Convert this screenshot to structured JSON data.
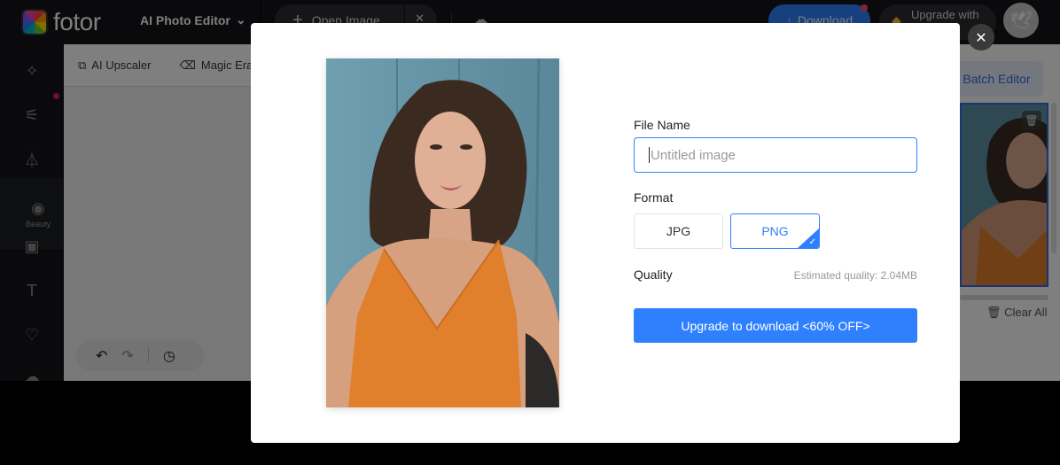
{
  "topbar": {
    "logo_text": "fotor",
    "editor_menu_label": "AI Photo Editor",
    "open_image_label": "Open Image",
    "download_label": "Download",
    "upgrade_label": "Upgrade with"
  },
  "sidebar": {
    "items": [
      {
        "icon": "ai-tools-icon",
        "glyph": "✧",
        "label": ""
      },
      {
        "icon": "adjust-icon",
        "glyph": "⚟",
        "label": ""
      },
      {
        "icon": "effects-icon",
        "glyph": "⏃",
        "label": ""
      },
      {
        "icon": "beauty-eye-icon",
        "glyph": "◉",
        "label": "Beauty"
      },
      {
        "icon": "frame-icon",
        "glyph": "▣",
        "label": ""
      },
      {
        "icon": "text-icon",
        "glyph": "T",
        "label": ""
      },
      {
        "icon": "elements-icon",
        "glyph": "♡",
        "label": ""
      },
      {
        "icon": "upload-icon",
        "glyph": "☁",
        "label": ""
      }
    ]
  },
  "toolrow": {
    "ai_upscaler": "AI Upscaler",
    "magic_eraser": "Magic Eraser"
  },
  "right_panel": {
    "batch_editor": "Batch Editor",
    "clear_all": "Clear All"
  },
  "modal": {
    "file_name_label": "File Name",
    "file_name_placeholder": "Untitled image",
    "file_name_value": "",
    "format_label": "Format",
    "formats": [
      "JPG",
      "PNG"
    ],
    "selected_format": "PNG",
    "quality_label": "Quality",
    "estimated_quality": "Estimated quality: 2.04MB",
    "upgrade_download_label": "Upgrade to download <60% OFF>"
  },
  "colors": {
    "accent": "#2f80ff",
    "dark_bg": "#141518"
  }
}
